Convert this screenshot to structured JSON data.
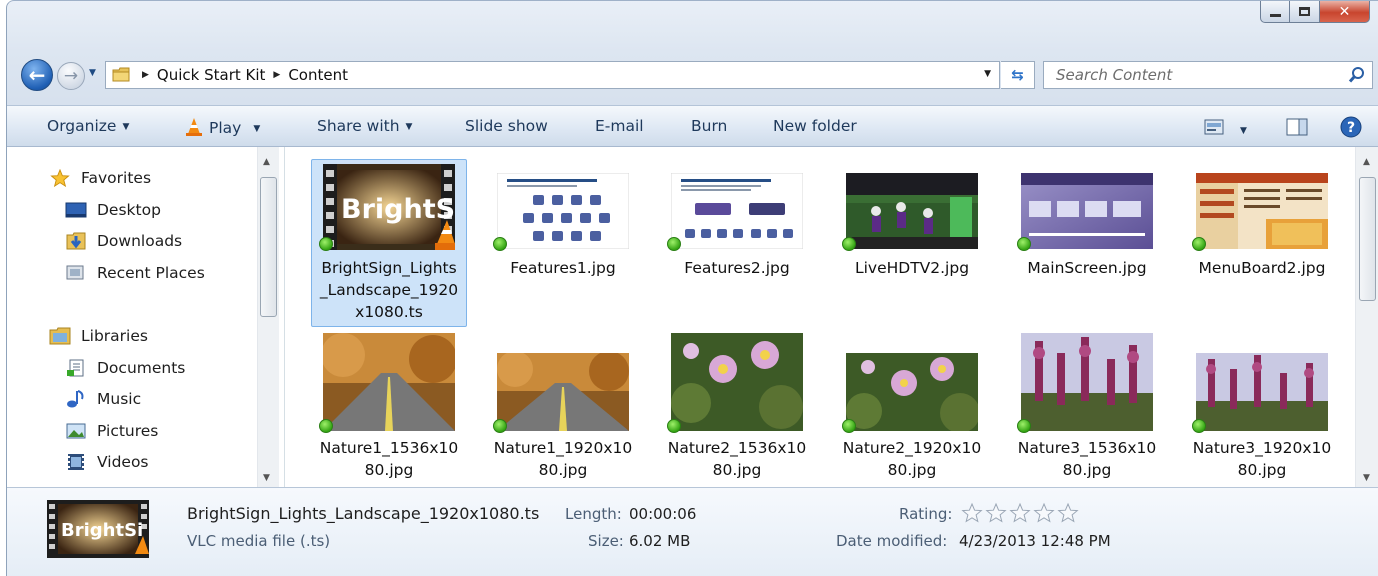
{
  "address": {
    "crumbs": [
      "Quick Start Kit",
      "Content"
    ]
  },
  "search": {
    "placeholder": "Search Content"
  },
  "toolbar": {
    "organize": "Organize",
    "play": "Play",
    "share_with": "Share with",
    "slide_show": "Slide show",
    "email": "E-mail",
    "burn": "Burn",
    "new_folder": "New folder"
  },
  "nav": {
    "favorites": "Favorites",
    "desktop": "Desktop",
    "downloads": "Downloads",
    "recent_places": "Recent Places",
    "libraries": "Libraries",
    "documents": "Documents",
    "music": "Music",
    "pictures": "Pictures",
    "videos": "Videos"
  },
  "files": [
    {
      "name_lines": [
        "BrightSign_Lights",
        "_Landscape_1920",
        "x1080.ts"
      ],
      "thumb_text": "BrightSig"
    },
    {
      "name_lines": [
        "Features1.jpg"
      ]
    },
    {
      "name_lines": [
        "Features2.jpg"
      ]
    },
    {
      "name_lines": [
        "LiveHDTV2.jpg"
      ]
    },
    {
      "name_lines": [
        "MainScreen.jpg"
      ]
    },
    {
      "name_lines": [
        "MenuBoard2.jpg"
      ]
    },
    {
      "name_lines": [
        "Nature1_1536x10",
        "80.jpg"
      ]
    },
    {
      "name_lines": [
        "Nature1_1920x10",
        "80.jpg"
      ]
    },
    {
      "name_lines": [
        "Nature2_1536x10",
        "80.jpg"
      ]
    },
    {
      "name_lines": [
        "Nature2_1920x10",
        "80.jpg"
      ]
    },
    {
      "name_lines": [
        "Nature3_1536x10",
        "80.jpg"
      ]
    },
    {
      "name_lines": [
        "Nature3_1920x10",
        "80.jpg"
      ]
    }
  ],
  "details": {
    "filename": "BrightSign_Lights_Landscape_1920x1080.ts",
    "filetype": "VLC media file (.ts)",
    "thumb_text": "BrightSi",
    "length_label": "Length:",
    "length_value": "00:00:06",
    "size_label": "Size:",
    "size_value": "6.02 MB",
    "rating_label": "Rating:",
    "date_label": "Date modified:",
    "date_value": "4/23/2013 12:48 PM"
  },
  "colors": {
    "accent": "#1f5fb4",
    "selection": "#cde3f9",
    "status_green": "#35a514"
  }
}
